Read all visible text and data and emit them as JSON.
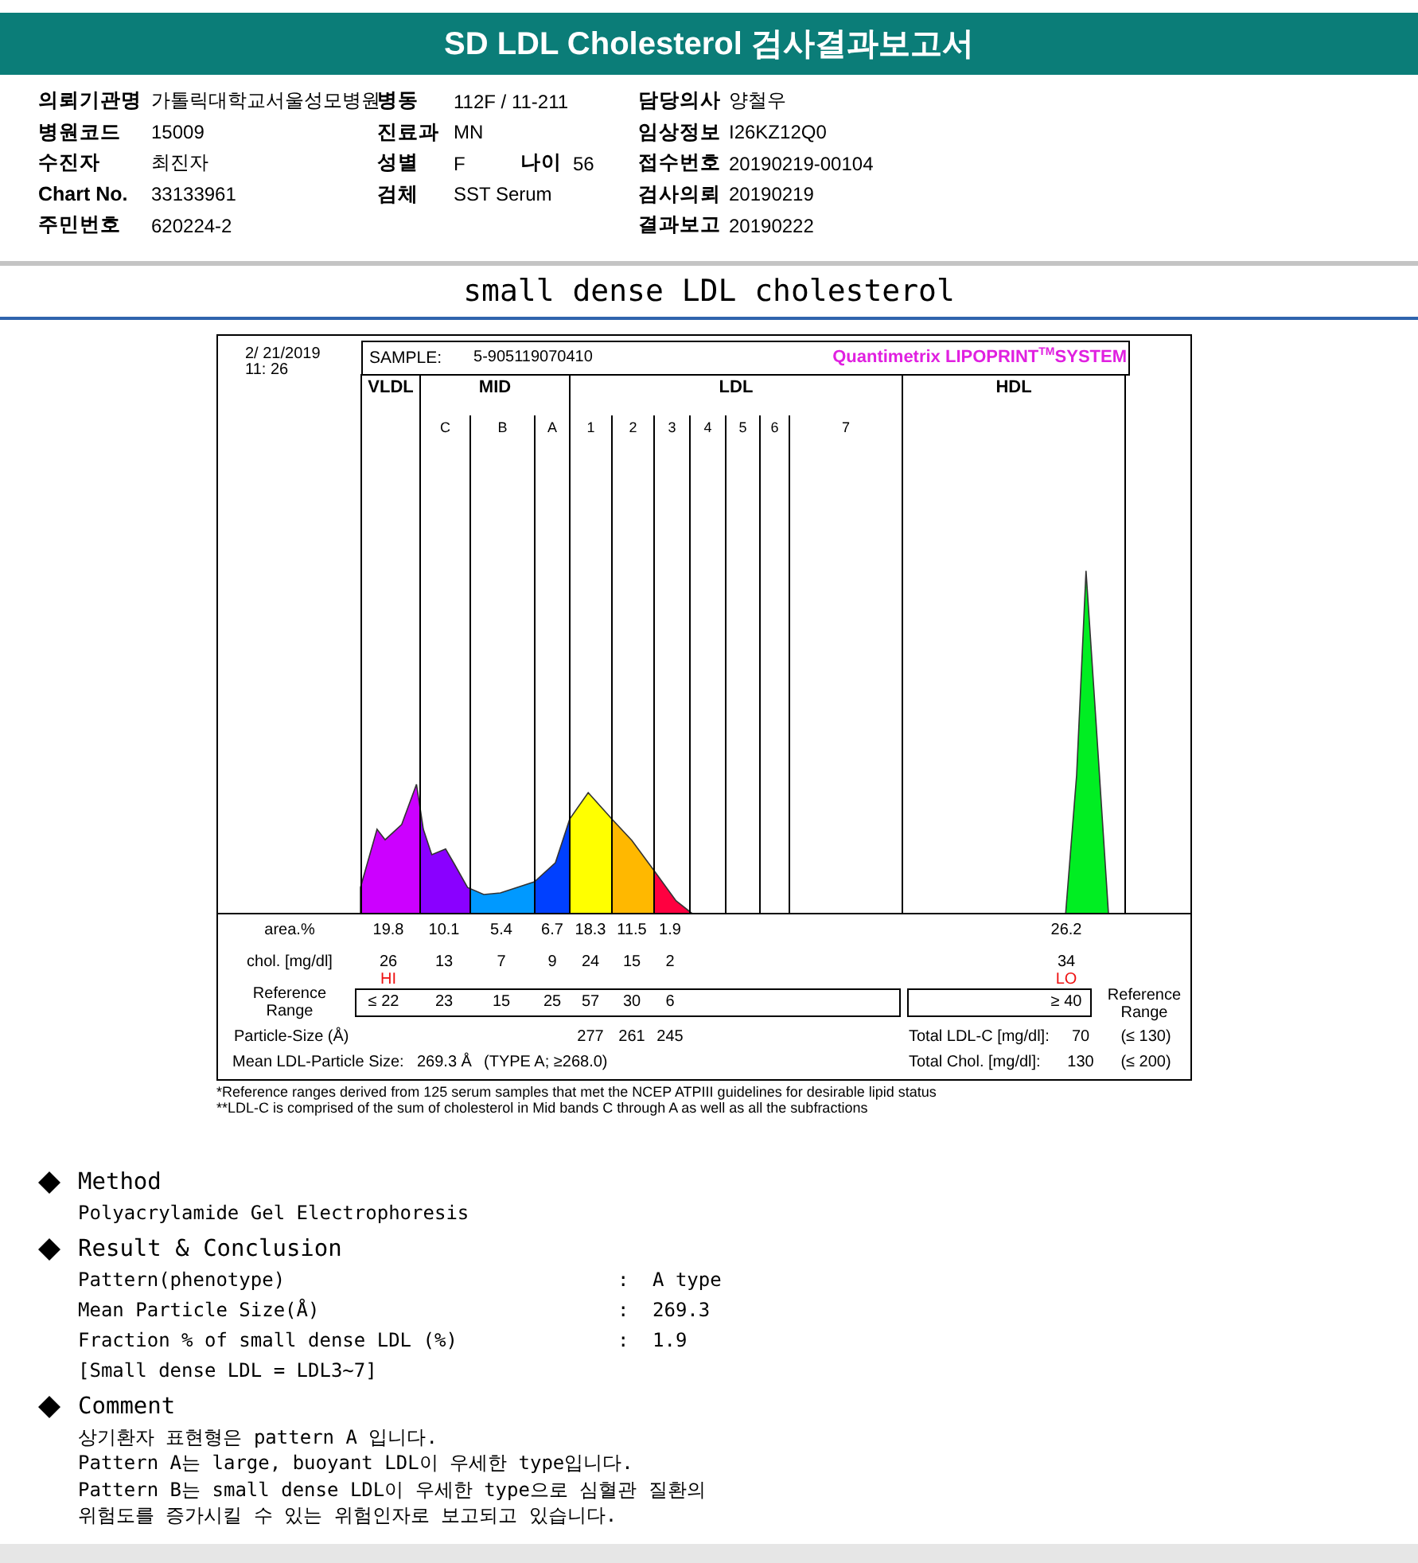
{
  "header": {
    "title": "SD LDL Cholesterol 검사결과보고서"
  },
  "patient_info": [
    {
      "left": {
        "label": "의뢰기관명",
        "value": "가톨릭대학교서울성모병원"
      },
      "middle": {
        "label": "병동",
        "value": "112F / 11-211"
      },
      "right": {
        "label": "담당의사",
        "value": "양철우"
      }
    },
    {
      "left": {
        "label": "병원코드",
        "value": "15009"
      },
      "middle": {
        "label": "진료과",
        "value": "MN"
      },
      "right": {
        "label": "임상정보",
        "value": "I26KZ12Q0"
      }
    },
    {
      "left": {
        "label": "수진자",
        "value": "최진자"
      },
      "middle": {
        "label": "성별",
        "value": "F",
        "extra": {
          "label": "나이",
          "value": "56"
        }
      },
      "right": {
        "label": "접수번호",
        "value": "20190219-00104"
      }
    },
    {
      "left": {
        "label": "Chart No.",
        "value": "33133961"
      },
      "middle": {
        "label": "검체",
        "value": "SST Serum"
      },
      "right": {
        "label": "검사의뢰",
        "value": "20190219"
      }
    },
    {
      "left": {
        "label": "주민번호",
        "value": "620224-2"
      },
      "right": {
        "label": "결과보고",
        "value": "20190222"
      }
    }
  ],
  "report": {
    "title": "small dense LDL cholesterol"
  },
  "chart": {
    "date": "2/ 21/2019",
    "time": "11: 26",
    "sample_label": "SAMPLE:",
    "sample_value": "5-905119070410",
    "brand": "Quantimetrix LIPOPRINT$^{TM}$SYSTEM",
    "groups": [
      {
        "label": "VLDL"
      },
      {
        "label": "MID",
        "subs": [
          "C",
          "B",
          "A"
        ]
      },
      {
        "label": "LDL",
        "subs": [
          "1",
          "2",
          "3",
          "4",
          "5",
          "6",
          "7"
        ]
      },
      {
        "label": "HDL"
      }
    ],
    "row_labels": {
      "area": "area.%",
      "chol": "chol. [mg/dl]",
      "reference": "Reference Range",
      "particle_size": "Particle-Size (Å)",
      "right_reference": "Reference Range"
    },
    "bands": [
      {
        "area": "19.8",
        "chol": "26",
        "flag": "HI",
        "reference": "≤ 22"
      },
      {
        "area": "10.1",
        "chol": "13",
        "reference": "23"
      },
      {
        "area": "5.4",
        "chol": "7",
        "reference": "15"
      },
      {
        "area": "6.7",
        "chol": "9",
        "reference": "25"
      },
      {
        "area": "18.3",
        "chol": "24",
        "reference": "57",
        "size": "277"
      },
      {
        "area": "11.5",
        "chol": "15",
        "reference": "30",
        "size": "261"
      },
      {
        "area": "1.9",
        "chol": "2",
        "reference": "6",
        "size": "245"
      }
    ],
    "hdl": {
      "area": "26.2",
      "chol": "34",
      "flag": "LO",
      "reference": "≥ 40"
    },
    "mean": {
      "label": "Mean LDL-Particle Size:",
      "value": "269.3 Å",
      "type": "(TYPE A; ≥268.0)"
    },
    "totals": [
      {
        "label": "Total LDL-C [mg/dl]:",
        "value": "70",
        "range": "(≤ 130)"
      },
      {
        "label": "Total Chol. [mg/dl]:",
        "value": "130",
        "range": "(≤ 200)"
      }
    ]
  },
  "footnotes": [
    "*Reference ranges derived from 125 serum samples that met the NCEP ATPIII guidelines for desirable lipid status",
    "**LDL-C is comprised of the sum of cholesterol in Mid bands C through A as well as all the subfractions"
  ],
  "sections": [
    {
      "kind": "text",
      "heading": "Method",
      "lines": [
        "Polyacrylamide Gel Electrophoresis"
      ]
    },
    {
      "kind": "results",
      "heading": "Result & Conclusion",
      "rows": [
        {
          "label": "Pattern(phenotype)",
          "separator": ":",
          "value": "A type"
        },
        {
          "label": "Mean Particle Size(Å)",
          "separator": ":",
          "value": "269.3"
        },
        {
          "label": "Fraction % of small dense LDL (%)",
          "separator": ":",
          "value": "1.9"
        }
      ],
      "note": "[Small dense LDL = LDL3~7]"
    },
    {
      "kind": "comment",
      "heading": "Comment",
      "lines": [
        "상기환자 표현형은 pattern A 입니다.",
        "Pattern A는 large, buoyant LDL이 우세한 type입니다.",
        "Pattern B는 small dense LDL이 우세한 type으로 심혈관 질환의",
        "위험도를 증가시킬 수 있는 위험인자로 보고되고 있습니다."
      ]
    }
  ]
}
